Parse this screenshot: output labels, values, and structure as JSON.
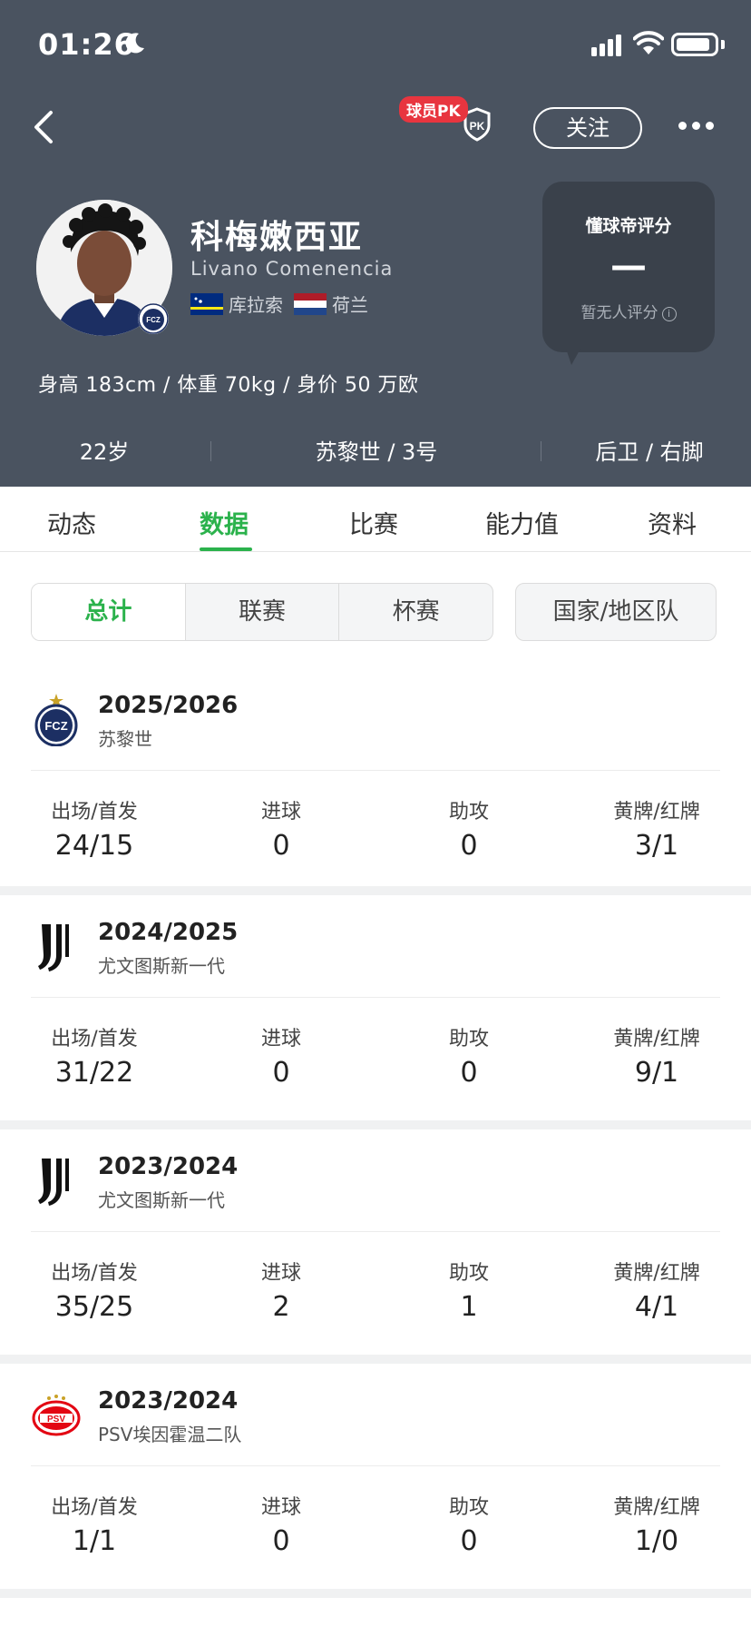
{
  "status_bar": {
    "time": "01:26"
  },
  "header": {
    "pk_badge": "球员PK",
    "follow_label": "关注",
    "player": {
      "name_cn": "科梅嫩西亚",
      "name_en": "Livano Comenencia",
      "nationalities": [
        "库拉索",
        "荷兰"
      ],
      "body_stats": "身高 183cm / 体重 70kg / 身价 50 万欧",
      "age": "22岁",
      "club_number": "苏黎世 / 3号",
      "position_foot": "后卫 / 右脚"
    },
    "rating": {
      "title": "懂球帝评分",
      "value": "—",
      "note": "暂无人评分"
    }
  },
  "tabs": [
    "动态",
    "数据",
    "比赛",
    "能力值",
    "资料"
  ],
  "active_tab": "数据",
  "filters": {
    "segments": [
      "总计",
      "联赛",
      "杯赛"
    ],
    "active": "总计",
    "national": "国家/地区队"
  },
  "stat_labels": {
    "apps": "出场/首发",
    "goals": "进球",
    "assists": "助攻",
    "cards": "黄牌/红牌"
  },
  "seasons": [
    {
      "year": "2025/2026",
      "team": "苏黎世",
      "logo": "fcz-logo",
      "apps": "24/15",
      "goals": "0",
      "assists": "0",
      "cards": "3/1"
    },
    {
      "year": "2024/2025",
      "team": "尤文图斯新一代",
      "logo": "juventus-logo",
      "apps": "31/22",
      "goals": "0",
      "assists": "0",
      "cards": "9/1"
    },
    {
      "year": "2023/2024",
      "team": "尤文图斯新一代",
      "logo": "juventus-logo",
      "apps": "35/25",
      "goals": "2",
      "assists": "1",
      "cards": "4/1"
    },
    {
      "year": "2023/2024",
      "team": "PSV埃因霍温二队",
      "logo": "psv-logo",
      "apps": "1/1",
      "goals": "0",
      "assists": "0",
      "cards": "1/0"
    }
  ],
  "colors": {
    "header_bg": "#4a5360",
    "accent_green": "#2bb24c",
    "pk_red": "#e8353f"
  },
  "logo_text": {
    "fcz": "FCZ",
    "psv": "PSV"
  }
}
